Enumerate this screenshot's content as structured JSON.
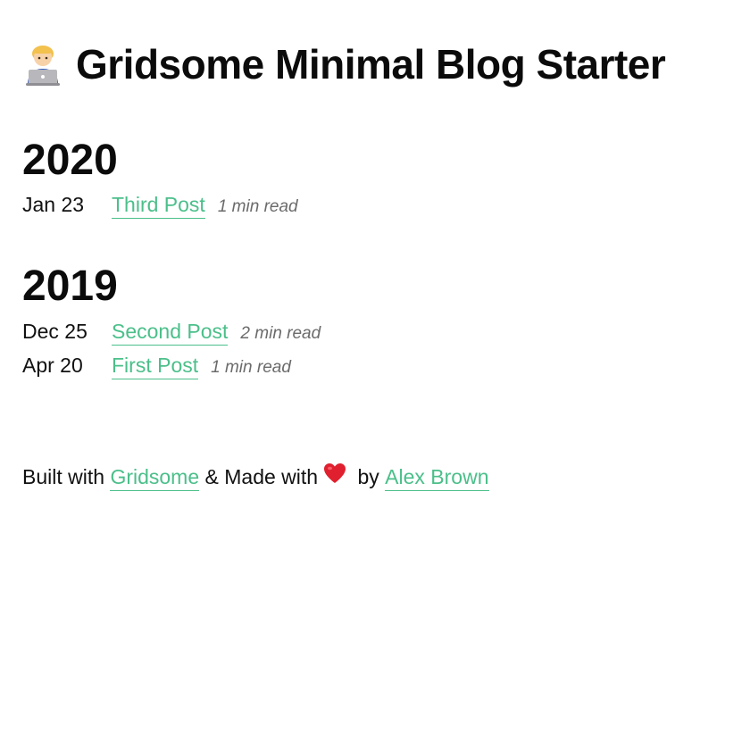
{
  "header": {
    "title": "Gridsome Minimal Blog Starter",
    "avatar_icon": "man-technologist-icon"
  },
  "years": [
    {
      "year": "2020",
      "posts": [
        {
          "date": "Jan 23",
          "title": "Third Post",
          "read_time": "1 min read"
        }
      ]
    },
    {
      "year": "2019",
      "posts": [
        {
          "date": "Dec 25",
          "title": "Second Post",
          "read_time": "2 min read"
        },
        {
          "date": "Apr 20",
          "title": "First Post",
          "read_time": "1 min read"
        }
      ]
    }
  ],
  "footer": {
    "built_with": "Built with",
    "gridsome_link": "Gridsome",
    "made_with": "& Made with",
    "heart_icon": "heart-icon",
    "by": "by",
    "author_link": "Alex Brown"
  },
  "colors": {
    "link": "#4bbf8a",
    "text": "#111111",
    "muted": "#6b6b6b",
    "heart": "#e0202e"
  }
}
